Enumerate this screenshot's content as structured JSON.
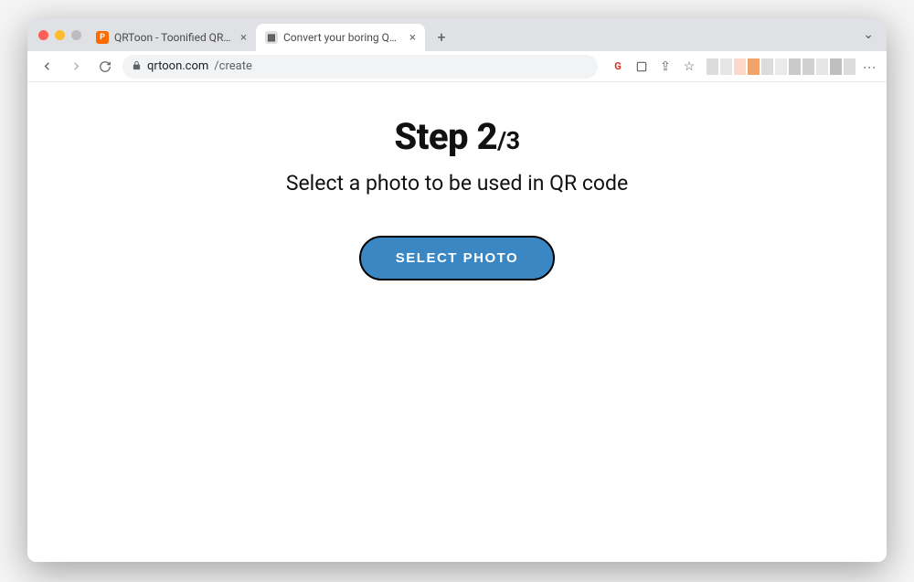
{
  "tabs": [
    {
      "title": "QRToon - Toonified QR Maker",
      "active": false
    },
    {
      "title": "Convert your boring QR codes",
      "active": true
    }
  ],
  "url": {
    "host": "qrtoon.com",
    "path": "/create"
  },
  "toolbar_icons": {
    "translate_badge": "G",
    "share": "⇪",
    "star": "☆"
  },
  "page": {
    "step_prefix": "Step ",
    "step_current": "2",
    "step_total": "/3",
    "subtitle": "Select a photo to be used in QR code",
    "button_label": "SELECT PHOTO"
  }
}
